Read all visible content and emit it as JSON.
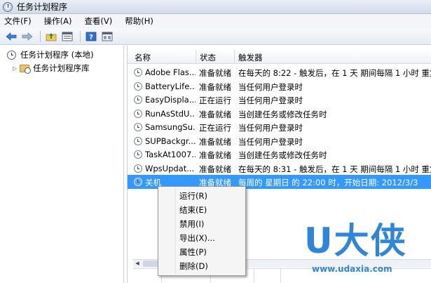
{
  "window": {
    "title": "任务计划程序"
  },
  "menubar": [
    "文件(F)",
    "操作(A)",
    "查看(V)",
    "帮助(H)"
  ],
  "toolbar": {
    "icons": [
      "back-arrow-icon",
      "forward-arrow-icon",
      "folder-up-icon",
      "properties-icon",
      "help-icon",
      "console-view-icon"
    ]
  },
  "tree": {
    "root": "任务计划程序 (本地)",
    "child": "任务计划程序库"
  },
  "table": {
    "columns": [
      "名称",
      "状态",
      "触发器"
    ],
    "rows": [
      {
        "name": "Adobe Flas...",
        "status": "准备就绪",
        "trigger": "在每天的 8:22 - 触发后，在 1 天 期间每隔 1 小时 重复"
      },
      {
        "name": "BatteryLife...",
        "status": "准备就绪",
        "trigger": "当任何用户登录时"
      },
      {
        "name": "EasyDispla...",
        "status": "正在运行",
        "trigger": "当任何用户登录时"
      },
      {
        "name": "RunAsStdU...",
        "status": "准备就绪",
        "trigger": "当创建任务或修改任务时"
      },
      {
        "name": "SamsungSu...",
        "status": "正在运行",
        "trigger": "当任何用户登录时"
      },
      {
        "name": "SUPBackgr...",
        "status": "准备就绪",
        "trigger": "当任何用户登录时"
      },
      {
        "name": "TaskAt1007...",
        "status": "准备就绪",
        "trigger": "当创建任务或修改任务时"
      },
      {
        "name": "WpsUpdat...",
        "status": "准备就绪",
        "trigger": "在每天的 8:31 - 触发后，在 1 天 期间每隔 1 小时 重复"
      },
      {
        "name": "关机",
        "status": "准备就绪",
        "trigger": "每周的 星期日 的 22:00 时，开始日期: 2012/3/3"
      }
    ],
    "selected_row": 8
  },
  "context_menu": [
    "运行(R)",
    "结束(E)",
    "禁用(I)",
    "导出(X)...",
    "属性(P)",
    "删除(D)"
  ],
  "watermark": {
    "logo": "U大侠",
    "url": "www.udaxia.com"
  }
}
